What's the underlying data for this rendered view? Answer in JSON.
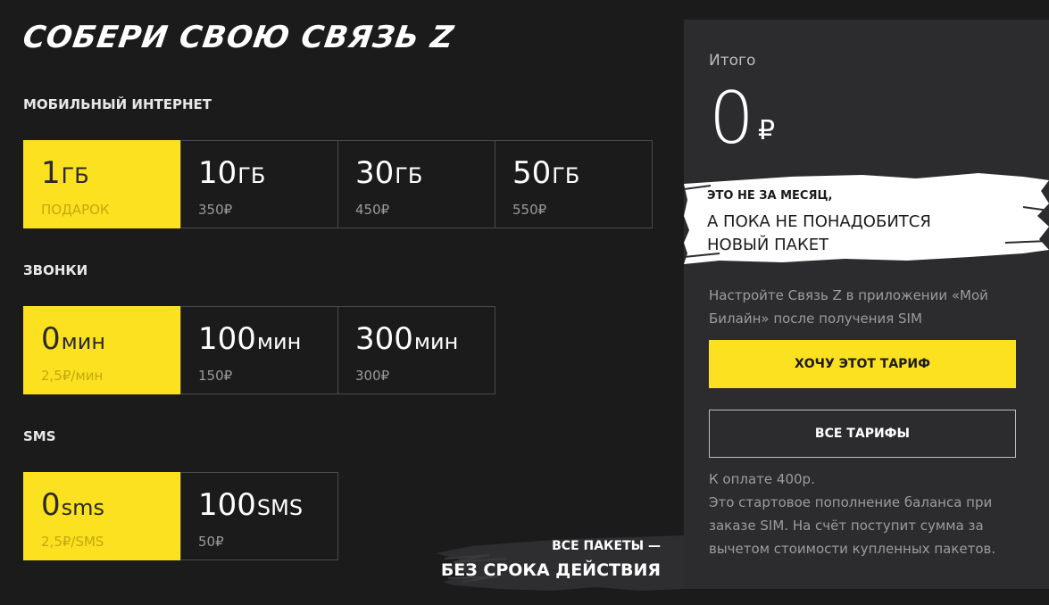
{
  "title": "СОБЕРИ СВОЮ СВЯЗЬ Z",
  "sections": {
    "internet": {
      "label": "МОБИЛЬНЫЙ ИНТЕРНЕТ",
      "options": [
        {
          "num": "1",
          "unit": "ГБ",
          "price": "ПОДАРОК",
          "selected": true
        },
        {
          "num": "10",
          "unit": "ГБ",
          "price": "350₽",
          "selected": false
        },
        {
          "num": "30",
          "unit": "ГБ",
          "price": "450₽",
          "selected": false
        },
        {
          "num": "50",
          "unit": "ГБ",
          "price": "550₽",
          "selected": false
        }
      ]
    },
    "calls": {
      "label": "ЗВОНКИ",
      "options": [
        {
          "num": "0",
          "unit": "мин",
          "price": "2,5₽/мин",
          "selected": true
        },
        {
          "num": "100",
          "unit": "мин",
          "price": "150₽",
          "selected": false
        },
        {
          "num": "300",
          "unit": "мин",
          "price": "300₽",
          "selected": false
        }
      ]
    },
    "sms": {
      "label": "SMS",
      "options": [
        {
          "num": "0",
          "unit": "sms",
          "price": "2,5₽/SMS",
          "selected": true
        },
        {
          "num": "100",
          "unit": "SMS",
          "price": "50₽",
          "selected": false
        }
      ]
    }
  },
  "packages_note": {
    "line1": "ВСЕ ПАКЕТЫ —",
    "line2": "БЕЗ СРОКА ДЕЙСТВИЯ"
  },
  "summary": {
    "total_label": "Итого",
    "total_value": "0",
    "currency": "₽",
    "brush_line1": "ЭТО НЕ ЗА МЕСЯЦ,",
    "brush_line2": "А ПОКА НЕ ПОНАДОБИТСЯ",
    "brush_line3": "НОВЫЙ ПАКЕТ",
    "hint": "Настройте Связь Z в приложении «Мой Билайн» после получения SIM",
    "primary_button": "ХОЧУ ЭТОТ ТАРИФ",
    "secondary_button": "ВСЕ ТАРИФЫ",
    "note_line1": "К оплате 400р.",
    "note_line2": "Это стартовое пополнение баланса при заказе SIM. На счёт поступит сумма за вычетом стоимости купленных пакетов."
  },
  "colors": {
    "background": "#1b1b1c",
    "panel": "#2c2c2e",
    "accent": "#fbe120"
  }
}
